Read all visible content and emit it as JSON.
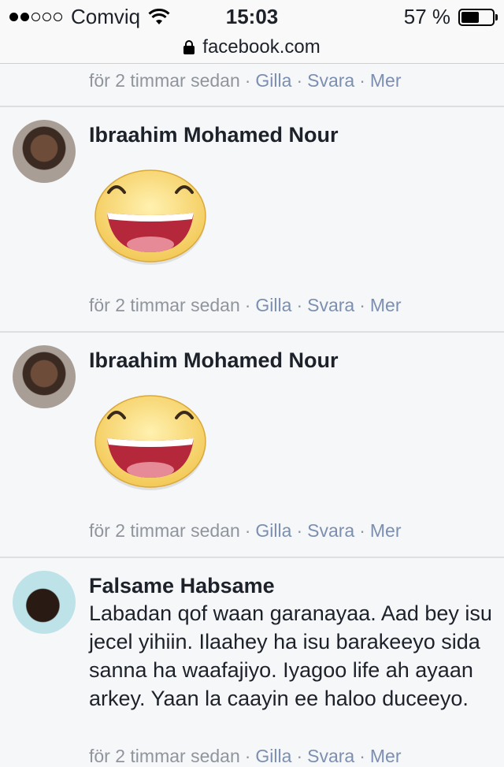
{
  "status_bar": {
    "carrier": "Comviq",
    "time": "15:03",
    "battery": "57 %",
    "battery_level": 0.57
  },
  "url_bar": {
    "domain": "facebook.com"
  },
  "top_meta": {
    "time": "för 2 timmar sedan",
    "like": "Gilla",
    "reply": "Svara",
    "more": "Mer"
  },
  "comments": [
    {
      "author": "Ibraahim Mohamed Nour",
      "content_icon": "laughing-emoji-sticker",
      "time": "för 2 timmar sedan",
      "like": "Gilla",
      "reply": "Svara",
      "more": "Mer"
    },
    {
      "author": "Ibraahim Mohamed Nour",
      "content_icon": "laughing-emoji-sticker",
      "time": "för 2 timmar sedan",
      "like": "Gilla",
      "reply": "Svara",
      "more": "Mer"
    },
    {
      "author": "Falsame Habsame",
      "text": "Labadan qof waan garanayaa. Aad bey isu jecel yihiin. Ilaahey ha isu barakeeyo sida sanna ha waafajiyo. Iyagoo life ah ayaan arkey. Yaan la caayin ee haloo duceeyo.",
      "time": "för 2 timmar sedan",
      "like": "Gilla",
      "reply": "Svara",
      "more": "Mer"
    }
  ]
}
